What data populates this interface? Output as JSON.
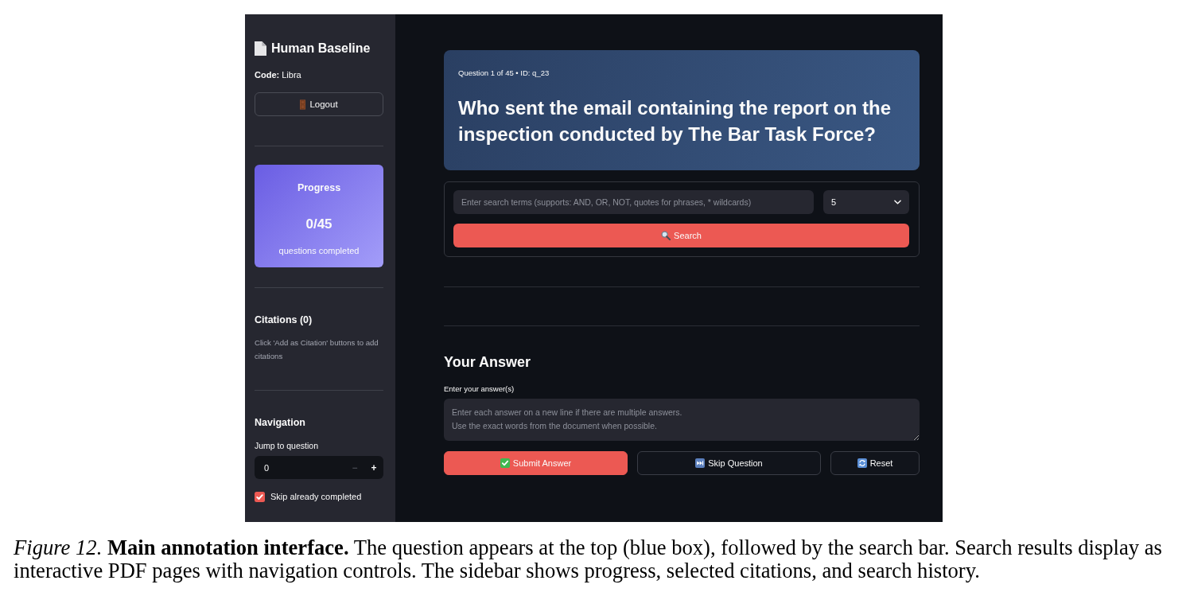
{
  "sidebar": {
    "title": "Human Baseline",
    "code": "**Code:** Libra",
    "logout_button": "Logout",
    "progress": {
      "heading": "Progress",
      "count": "0/45",
      "caption": "questions completed"
    },
    "citations": {
      "heading": "Citations (0)",
      "hint": "Click 'Add as Citation' buttons to add citations"
    },
    "navigation": {
      "heading": "Navigation",
      "jump_label": "Jump to question",
      "jump_value": "0",
      "steppers": [
        {
          "label": "−",
          "disabled": true
        },
        {
          "label": "+",
          "disabled": false
        }
      ],
      "skip_completed": {
        "label": "Skip already completed",
        "checked": true
      }
    }
  },
  "question": {
    "meta": "Question 1 of 45 • ID: q_23",
    "text": "Who sent the email containing the report on the inspection conducted by The Bar Task Force?"
  },
  "search": {
    "placeholder": "Enter search terms (supports: AND, OR, NOT, quotes for phrases, * wildcards)",
    "results_count": "5",
    "button": "Search"
  },
  "answer": {
    "heading": "Your Answer",
    "label": "Enter your answer(s)",
    "placeholder": "Enter each answer on a new line if there are multiple answers.\nUse the exact words from the document when possible."
  },
  "actions": [
    {
      "kind": "submit",
      "label": "Submit Answer"
    },
    {
      "kind": "skip",
      "label": "Skip Question"
    },
    {
      "kind": "reset",
      "label": "Reset"
    }
  ],
  "caption": "*Figure 12.* **Main annotation interface.** The question appears at the top (blue box), followed by the search bar. Search results display as interactive PDF pages with navigation controls. The sidebar shows progress, selected citations, and search history."
}
